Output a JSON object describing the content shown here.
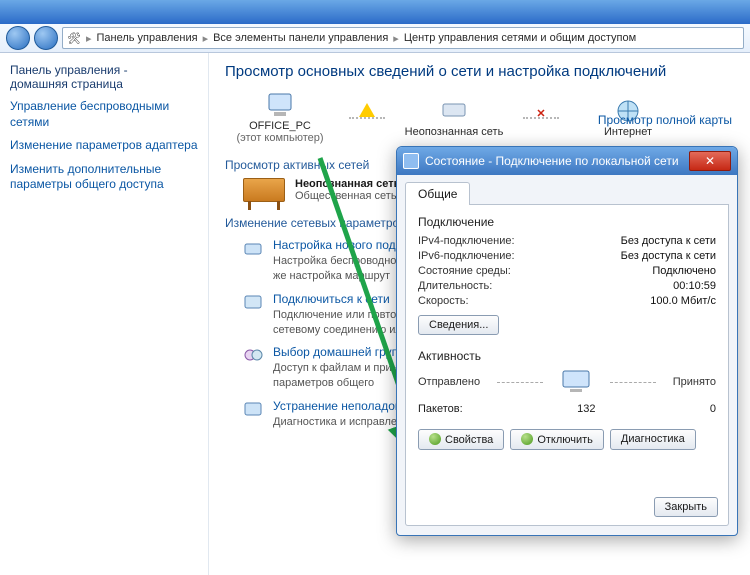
{
  "breadcrumb": {
    "p1": "Панель управления",
    "p2": "Все элементы панели управления",
    "p3": "Центр управления сетями и общим доступом"
  },
  "sidebar": {
    "title_l1": "Панель управления -",
    "title_l2": "домашняя страница",
    "links": [
      "Управление беспроводными сетями",
      "Изменение параметров адаптера",
      "Изменить дополнительные параметры общего доступа"
    ]
  },
  "main": {
    "heading": "Просмотр основных сведений о сети и настройка подключений",
    "fullMap": "Просмотр полной карты",
    "nodes": {
      "pc_name": "OFFICE_PC",
      "pc_sub": "(этот компьютер)",
      "unknown": "Неопознанная сеть",
      "internet": "Интернет"
    },
    "sec_active": "Просмотр активных сетей",
    "net": {
      "name": "Неопознанная сеть",
      "type": "Общественная сеть"
    },
    "sec_params": "Изменение сетевых параметров",
    "params": [
      {
        "link": "Настройка нового подключения",
        "desc": "Настройка беспроводного, широкополосного, или же настройка маршрут"
      },
      {
        "link": "Подключиться к сети",
        "desc": "Подключение или повторное подключение к сетевому соединению или по"
      },
      {
        "link": "Выбор домашней группы и параметров",
        "desc": "Доступ к файлам и принтерам, изменение параметров общего"
      },
      {
        "link": "Устранение неполадок",
        "desc": "Диагностика и исправление сетевых"
      }
    ]
  },
  "dialog": {
    "title": "Состояние - Подключение по локальной сети",
    "tab": "Общие",
    "conn_hdr": "Подключение",
    "kv": {
      "ipv4_k": "IPv4-подключение:",
      "ipv4_v": "Без доступа к сети",
      "ipv6_k": "IPv6-подключение:",
      "ipv6_v": "Без доступа к сети",
      "media_k": "Состояние среды:",
      "media_v": "Подключено",
      "dur_k": "Длительность:",
      "dur_v": "00:10:59",
      "spd_k": "Скорость:",
      "spd_v": "100.0 Мбит/с"
    },
    "details": "Сведения...",
    "act_hdr": "Активность",
    "sent": "Отправлено",
    "recv": "Принято",
    "pkt_label": "Пакетов:",
    "pkt_sent": "132",
    "pkt_recv": "0",
    "btn_props": "Свойства",
    "btn_disable": "Отключить",
    "btn_diag": "Диагностика",
    "btn_close": "Закрыть"
  }
}
